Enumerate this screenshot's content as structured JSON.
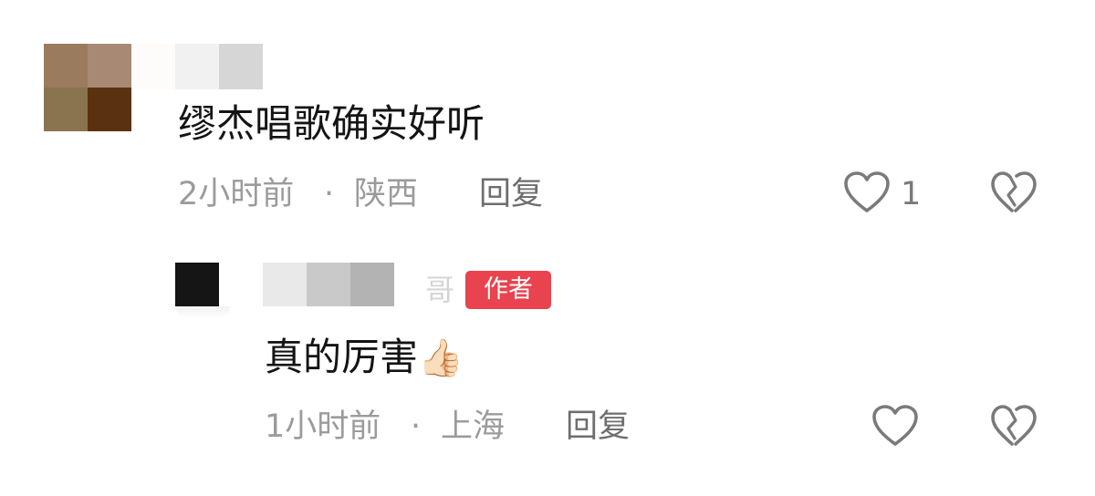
{
  "comments": [
    {
      "text": "缪杰唱歌确实好听",
      "time": "2小时前",
      "separator": "·",
      "location": "陕西",
      "reply_label": "回复",
      "like_count": "1",
      "icons": [
        "heart-icon",
        "broken-heart-icon"
      ]
    },
    {
      "name_suffix": "哥",
      "author_badge": "作者",
      "text": "真的厉害",
      "emoji": "👍🏻",
      "time": "1小时前",
      "separator": "·",
      "location": "上海",
      "reply_label": "回复",
      "icons": [
        "heart-icon",
        "broken-heart-icon"
      ]
    }
  ],
  "colors": {
    "author_badge_bg": "#e8434f",
    "meta_text": "#9b9b9b",
    "icon_stroke": "#7a7a7a"
  }
}
